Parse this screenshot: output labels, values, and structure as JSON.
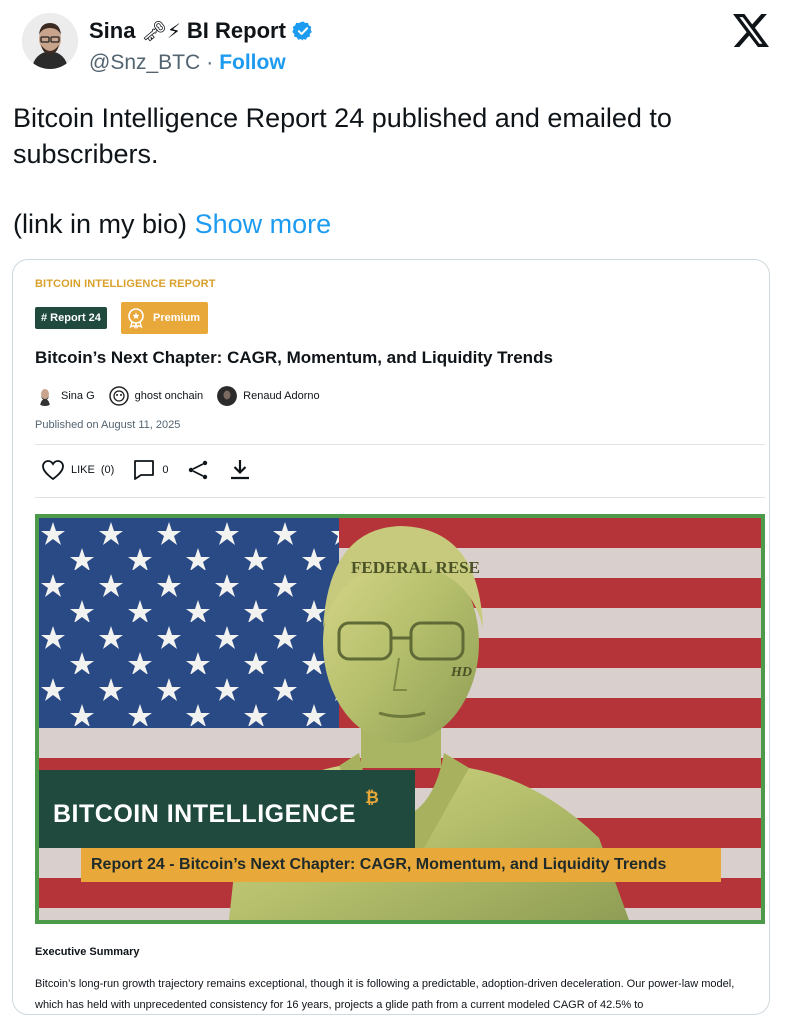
{
  "author": {
    "name": "Sina",
    "emoji": "🗝⚡",
    "label": "BI Report",
    "handle": "@Snz_BTC",
    "separator": "·",
    "follow_label": "Follow"
  },
  "tweet": {
    "line1": "Bitcoin Intelligence Report 24 published and emailed to subscribers.",
    "line2": "(link in my bio)",
    "show_more": "Show more"
  },
  "card": {
    "report_label": "BITCOIN INTELLIGENCE REPORT",
    "tag_report": "# Report 24",
    "tag_premium": "Premium",
    "title": "Bitcoin’s Next Chapter: CAGR, Momentum, and Liquidity Trends",
    "authors": [
      "Sina G",
      "ghost onchain",
      "Renaud Adorno"
    ],
    "published": "Published on August 11, 2025",
    "actions": {
      "like_label": "LIKE",
      "like_count": "(0)",
      "comment_count": "0"
    },
    "hero": {
      "banner": "BITCOIN INTELLIGENCE",
      "btc_mark": "₿",
      "subtitle": "Report 24 - Bitcoin’s Next Chapter: CAGR, Momentum, and Liquidity Trends",
      "statue_text": "FEDERAL RESE",
      "initials": "HD"
    },
    "exec_title": "Executive Summary",
    "exec_body": "Bitcoin’s long-run growth trajectory remains exceptional, though it is following a predictable, adoption-driven deceleration. Our power-law model, which has held with unprecedented consistency for 16 years, projects a glide path from a current modeled CAGR of 42.5% to"
  },
  "colors": {
    "accent_blue": "#1d9bf0",
    "report_gold": "#d9a02c",
    "premium_orange": "#e9a83a",
    "dark_green": "#1f4a3d",
    "frame_green": "#4c9a4a",
    "flag_red": "#b5343a",
    "flag_blue": "#2a4a86"
  },
  "icons": [
    "verified-badge-icon",
    "x-logo-icon",
    "heart-icon",
    "comment-icon",
    "share-icon",
    "download-icon",
    "premium-ribbon-icon"
  ]
}
